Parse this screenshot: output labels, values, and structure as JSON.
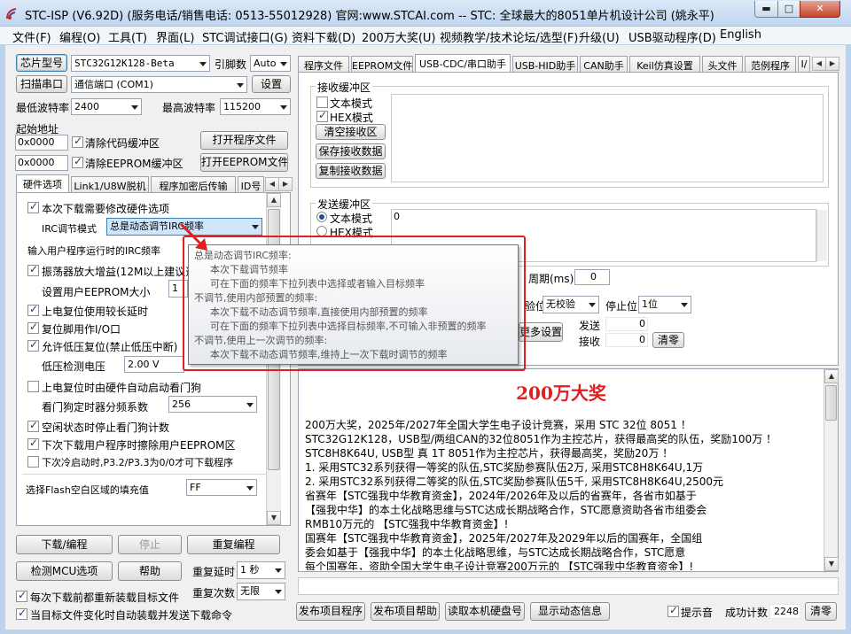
{
  "window": {
    "title": "STC-ISP (V6.92D) (服务电话/销售电话: 0513-55012928) 官网:www.STCAI.com  -- STC: 全球最大的8051单片机设计公司 (姚永平)",
    "min_symbol": "▬",
    "max_symbol": "□",
    "close_symbol": "✕"
  },
  "menu": [
    "文件(F)",
    "编程(O)",
    "工具(T)",
    "界面(L)",
    "STC调试接口(G)",
    "资料下载(D)",
    "200万大奖(U)",
    "视频教学/技术论坛/选型(F)",
    "升级(U)",
    "USB驱动程序(D)",
    "English"
  ],
  "left": {
    "chip_model_label": "芯片型号",
    "chip_model_value": "STC32G12K128-Beta",
    "pin_count_label": "引脚数",
    "pin_count_value": "Auto",
    "scan_port_label": "扫描串口",
    "port_value": "通信端口 (COM1)",
    "settings_label": "设置",
    "min_baud_label": "最低波特率",
    "min_baud_value": "2400",
    "max_baud_label": "最高波特率",
    "max_baud_value": "115200",
    "start_addr_label": "起始地址",
    "code_addr_value": "0x0000",
    "clear_code_buffer": "清除代码缓冲区",
    "open_program_file": "打开程序文件",
    "eeprom_addr_value": "0x0000",
    "clear_eeprom_buffer": "清除EEPROM缓冲区",
    "open_eeprom_file": "打开EEPROM文件",
    "tabs": [
      "硬件选项",
      "Link1/U8W脱机",
      "程序加密后传输",
      "ID号"
    ],
    "hw": {
      "opt_modify_hw": "本次下载需要修改硬件选项",
      "irc_mode_label": "IRC调节模式",
      "irc_mode_value": "总是动态调节IRC频率",
      "irc_freq_label": "输入用户程序运行时的IRC频率",
      "osc_gain": "振荡器放大增益(12M以上建议选择)",
      "eeprom_size_label": "设置用户EEPROM大小",
      "eeprom_size_value": "1",
      "reset_long_delay": "上电复位使用较长延时",
      "reset_pin_io": "复位脚用作I/O口",
      "lvr": "允许低压复位(禁止低压中断)",
      "lvd_label": "低压检测电压",
      "lvd_value": "2.00 V",
      "wdt_auto": "上电复位时由硬件自动启动看门狗",
      "wdt_div_label": "看门狗定时器分频系数",
      "wdt_div_value": "256",
      "idle_stop_wdt": "空闲状态时停止看门狗计数",
      "erase_eeprom": "下次下载用户程序时擦除用户EEPROM区",
      "p32p33": "下次冷启动时,P3.2/P3.3为0/0才可下载程序",
      "flash_fill_label": "选择Flash空白区域的填充值",
      "flash_fill_value": "FF"
    },
    "download_btn": "下载/编程",
    "stop_btn": "停止",
    "reprogram_btn": "重复编程",
    "detect_mcu_btn": "检测MCU选项",
    "help_btn": "帮助",
    "repeat_delay_label": "重复延时",
    "repeat_delay_value": "1 秒",
    "repeat_count_label": "重复次数",
    "repeat_count_value": "无限",
    "reload_before_download": "每次下载前都重新装载目标文件",
    "auto_send_on_change": "当目标文件变化时自动装载并发送下载命令"
  },
  "right": {
    "tabs": [
      "程序文件",
      "EEPROM文件",
      "USB-CDC/串口助手",
      "USB-HID助手",
      "CAN助手",
      "Keil仿真设置",
      "头文件",
      "范例程序",
      "I/"
    ],
    "recv_title": "接收缓冲区",
    "recv_text_mode": "文本模式",
    "recv_hex_mode": "HEX模式",
    "clear_recv": "清空接收区",
    "save_recv": "保存接收数据",
    "copy_recv": "复制接收数据",
    "send_title": "发送缓冲区",
    "send_text_mode": "文本模式",
    "send_hex_mode": "HEX模式",
    "send_value": "0",
    "period_label": "周期(ms)",
    "period_value": "0",
    "parity_label": "验位",
    "parity_value": "无校验",
    "stop_bits_label": "停止位",
    "stop_bits_value": "1位",
    "more_settings": "更多设置",
    "sent_label": "发送",
    "sent_value": "0",
    "received_label": "接收",
    "received_value": "0",
    "clear_counts": "清零",
    "prize_title": "200万大奖",
    "prize_lines": [
      "200万大奖，2025年/2027年全国大学生电子设计竞赛，采用 STC 32位 8051 ！",
      "STC32G12K128，USB型/两组CAN的32位8051作为主控芯片，获得最高奖的队伍，奖励100万 ！",
      "STC8H8K64U, USB型 真 1T 8051作为主控芯片，获得最高奖，奖励20万 ！",
      "1. 采用STC32系列获得一等奖的队伍,STC奖励参赛队伍2万, 采用STC8H8K64U,1万",
      "2. 采用STC32系列获得二等奖的队伍,STC奖励参赛队伍5千, 采用STC8H8K64U,2500元",
      "省赛年【STC强我中华教育资金】，2024年/2026年及以后的省赛年，各省市如基于",
      "【强我中华】的本土化战略思维与STC达成长期战略合作，STC愿意资助各省市组委会",
      "RMB10万元的 【STC强我中华教育资金】!",
      "国赛年【STC强我中华教育资金】，2025年/2027年及2029年以后的国赛年，全国组",
      "委会如基于【强我中华】的本土化战略思维，与STC达成长期战略合作，STC愿意",
      "每个国赛年，资助全国大学生电子设计竞赛200万元的 【STC强我中华教育资金】!"
    ],
    "publish_project_btn": "发布项目程序",
    "publish_help_btn": "发布项目帮助",
    "read_serial_btn": "读取本机硬盘号",
    "show_animation_btn": "显示动态信息",
    "beep_label": "提示音",
    "success_count_label": "成功计数",
    "success_count_value": "2248",
    "clear_success_btn": "清零"
  },
  "tooltip": {
    "lines": [
      "总是动态调节IRC频率:",
      "本次下载调节频率",
      "可在下面的频率下拉列表中选择或者输入目标频率",
      "不调节,使用内部预置的频率:",
      "本次下载不动态调节频率,直接使用内部预置的频率",
      "可在下面的频率下拉列表中选择目标频率,不可输入非预置的频率",
      "不调节,使用上一次调节的频率:",
      "本次下载不动态调节频率,维持上一次下载时调节的频率"
    ]
  },
  "colors": {
    "prize_title": "#e02020",
    "highlight": "#e02020",
    "titlebar": "#c0d6f0"
  }
}
